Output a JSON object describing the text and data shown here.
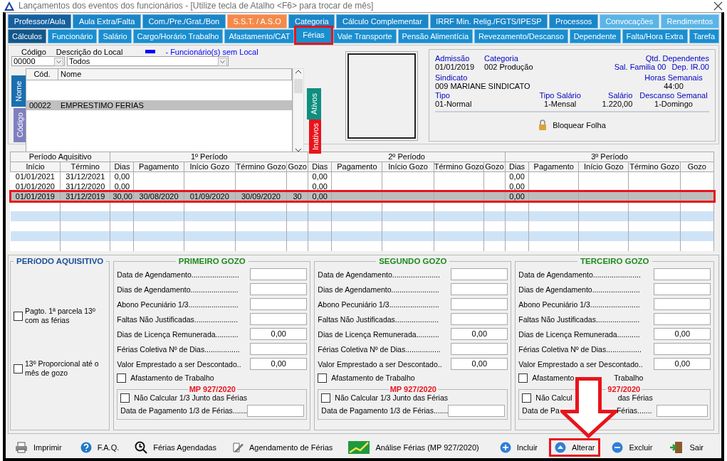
{
  "window": {
    "title": "Lançamentos dos eventos dos funcionários - [Utilize tecla de Atalho <F6> para trocar de mês]"
  },
  "tab_rows": [
    [
      {
        "label": "Professor/Aula",
        "color": "#15609e",
        "selected": false,
        "highlighted": false
      },
      {
        "label": "Aula Extra/Falta",
        "color": "#1a86c8",
        "selected": false,
        "highlighted": false
      },
      {
        "label": "Com./Pre./Grat./Bon",
        "color": "#1a86c8",
        "selected": false,
        "highlighted": false
      },
      {
        "label": "S.S.T. / A.S.O",
        "color": "#f5894a",
        "selected": false,
        "highlighted": false
      },
      {
        "label": "Categoria",
        "color": "#1a86c8",
        "selected": false,
        "highlighted": false
      },
      {
        "label": "Cálculo Complementar",
        "color": "#1a86c8",
        "selected": false,
        "highlighted": false
      },
      {
        "label": "IRRF Min. Relig./FGTS/IPESP",
        "color": "#1a86c8",
        "selected": false,
        "highlighted": false
      },
      {
        "label": "Processos",
        "color": "#1a86c8",
        "selected": false,
        "highlighted": false
      },
      {
        "label": "Convocações",
        "color": "#5ab4e6",
        "selected": false,
        "highlighted": false
      },
      {
        "label": "Rendimentos",
        "color": "#5ab4e6",
        "selected": false,
        "highlighted": false
      }
    ],
    [
      {
        "label": "Cálculos",
        "color": "#13578a",
        "selected": false,
        "highlighted": false
      },
      {
        "label": "Funcionário",
        "color": "#1a8fd0",
        "selected": false,
        "highlighted": false
      },
      {
        "label": "Salário",
        "color": "#1a8fd0",
        "selected": false,
        "highlighted": false
      },
      {
        "label": "Cargo/Horário Trabalho",
        "color": "#1a8fd0",
        "selected": false,
        "highlighted": false
      },
      {
        "label": "Afastamento/CAT",
        "color": "#1a8fd0",
        "selected": false,
        "highlighted": false
      },
      {
        "label": "Férias",
        "color": "#1a8fd0",
        "selected": true,
        "highlighted": true
      },
      {
        "label": "Vale Transporte",
        "color": "#1a8fd0",
        "selected": false,
        "highlighted": false
      },
      {
        "label": "Pensão Alimentícia",
        "color": "#1a8fd0",
        "selected": false,
        "highlighted": false
      },
      {
        "label": "Revezamento/Descanso",
        "color": "#1a8fd0",
        "selected": false,
        "highlighted": false
      },
      {
        "label": "Dependente",
        "color": "#1a8fd0",
        "selected": false,
        "highlighted": false
      },
      {
        "label": "Falta/Hora Extra",
        "color": "#1a8fd0",
        "selected": false,
        "highlighted": false
      },
      {
        "label": "Tarefa",
        "color": "#1a8fd0",
        "selected": false,
        "highlighted": false
      }
    ]
  ],
  "filter": {
    "code_label": "Código",
    "code_value": "00000",
    "local_label": "Descrição do Local",
    "local_value": "Todos",
    "legend": "- Funcionário(s) sem Local"
  },
  "employee_list": {
    "side_tabs": [
      {
        "label": "Nome",
        "color": "#1a6fb0",
        "selected": true
      },
      {
        "label": "Código",
        "color": "#7f7fc0",
        "selected": false
      }
    ],
    "columns": [
      "Cód.",
      "Nome"
    ],
    "rows": [
      {
        "code": "00022",
        "name": "EMPRESTIMO FERIAS",
        "selected": true
      }
    ],
    "status_tabs": [
      {
        "label": "Ativos",
        "color": "#0f8f80",
        "selected": true
      },
      {
        "label": "Inativos",
        "color": "#e8141c",
        "selected": false
      }
    ]
  },
  "employee_info": {
    "admissao": {
      "label": "Admissão",
      "value": "01/01/2019"
    },
    "categoria": {
      "label": "Categoria",
      "value": "002  Produção"
    },
    "dependentes": {
      "label": "Qtd. Dependentes",
      "sal_familia": "Sal. Familia 00",
      "dep_ir": "Dep. IR.00"
    },
    "sindicato": {
      "label": "Sindicato",
      "value": "009  MARIANE SINDICATO"
    },
    "horas": {
      "label": "Horas Semanais",
      "value": "44:00"
    },
    "tipo": {
      "label": "Tipo",
      "value": "01-Normal"
    },
    "tipo_salario": {
      "label": "Tipo Salário",
      "value": "1-Mensal"
    },
    "salario": {
      "label": "Salário",
      "value": "1.220,00"
    },
    "descanso": {
      "label": "Descanso Semanal",
      "value": "1-Domingo"
    },
    "lock_label": "Bloquear Folha"
  },
  "periods_table": {
    "group_headers": [
      "Período Aquisitivo",
      "1º Período",
      "2º Período",
      "3º Período"
    ],
    "columns": [
      "Início",
      "Término",
      "Dias",
      "Pagamento",
      "Início Gozo",
      "Término Gozo",
      "Gozo",
      "Dias",
      "Pagamento",
      "Início Gozo",
      "Término Gozo",
      "Gozo",
      "Dias",
      "Pagamento",
      "Início Gozo",
      "Término Gozo",
      "Gozo"
    ],
    "rows": [
      {
        "inicio": "01/01/2021",
        "termino": "31/12/2021",
        "selected": false,
        "highlighted": false,
        "periods": [
          {
            "dias": "0,00"
          },
          {
            "dias": "0,00"
          },
          {
            "dias": "0,00"
          }
        ]
      },
      {
        "inicio": "01/01/2020",
        "termino": "31/12/2020",
        "selected": false,
        "highlighted": false,
        "periods": [
          {
            "dias": "0,00"
          },
          {
            "dias": "0,00"
          },
          {
            "dias": "0,00"
          }
        ]
      },
      {
        "inicio": "01/01/2019",
        "termino": "31/12/2019",
        "selected": true,
        "highlighted": true,
        "periods": [
          {
            "dias": "30,00",
            "pagamento": "30/08/2020",
            "inicio_gozo": "01/09/2020",
            "termino_gozo": "30/09/2020",
            "gozo": "30"
          },
          {
            "dias": "0,00"
          },
          {
            "dias": "0,00"
          }
        ]
      }
    ]
  },
  "periodo_aquisitivo": {
    "title": "PERíODO AQUISITIVO",
    "options": [
      {
        "label": "Pagto. 1ª parcela 13º com as férias",
        "checked": false
      },
      {
        "label": "13º Proporcional até o mês de gozo",
        "checked": false
      }
    ]
  },
  "gozos": [
    {
      "title": "PRIMEIRO GOZO",
      "arrow_over": false,
      "fields": [
        {
          "label": "Data de Agendamento......................."
        },
        {
          "label": "Dias de Agendamento......................."
        },
        {
          "label": "Abono Pecuniário 1/3........................"
        },
        {
          "label": "Faltas Não Justificadas....................."
        },
        {
          "label": "Dias de Licença Remunerada...........",
          "value": "0,00"
        },
        {
          "label": "Férias Coletiva Nº de Dias................."
        },
        {
          "label": "Valor Emprestado a ser Descontado..",
          "value": "0,00"
        }
      ],
      "afastamento": {
        "label_parts": [
          "Afastamento de Trabalho"
        ],
        "checked": false
      },
      "mp_title_parts": [
        "MP 927/2020"
      ],
      "mp_option": {
        "label_parts": [
          "Não Calcular 1/3 Junto das Férias"
        ],
        "checked": false
      },
      "mp_field": {
        "label_parts": [
          "Data de Pagamento 1/3 de Férias......."
        ]
      }
    },
    {
      "title": "SEGUNDO GOZO",
      "arrow_over": false,
      "fields": [
        {
          "label": "Data de Agendamento......................."
        },
        {
          "label": "Dias de Agendamento......................."
        },
        {
          "label": "Abono Pecuniário 1/3........................"
        },
        {
          "label": "Faltas Não Justificadas....................."
        },
        {
          "label": "Dias de Licença Remunerada...........",
          "value": "0,00"
        },
        {
          "label": "Férias Coletiva Nº de Dias................."
        },
        {
          "label": "Valor Emprestado a ser Descontado..",
          "value": "0,00"
        }
      ],
      "afastamento": {
        "label_parts": [
          "Afastamento de Trabalho"
        ],
        "checked": false
      },
      "mp_title_parts": [
        "MP 927/2020"
      ],
      "mp_option": {
        "label_parts": [
          "Não Calcular 1/3 Junto das Férias"
        ],
        "checked": false
      },
      "mp_field": {
        "label_parts": [
          "Data de Pagamento 1/3 de Férias......."
        ]
      }
    },
    {
      "title": "TERCEIRO GOZO",
      "arrow_over": true,
      "fields": [
        {
          "label": "Data de Agendamento......................."
        },
        {
          "label": "Dias de Agendamento......................."
        },
        {
          "label": "Abono Pecuniário 1/3........................"
        },
        {
          "label": "Faltas Não Justificadas....................."
        },
        {
          "label": "Dias de Licença Remunerada...........",
          "value": "0,00"
        },
        {
          "label": "Férias Coletiva Nº de Dias................."
        },
        {
          "label": "Valor Emprestado a ser Descontado..",
          "value": "0,00"
        }
      ],
      "afastamento": {
        "label_parts": [
          "Afastamento",
          "Trabalho"
        ],
        "checked": false
      },
      "mp_title_parts": [
        "927/2020"
      ],
      "mp_option": {
        "label_parts": [
          "Não Calcul",
          "das Férias"
        ],
        "checked": false
      },
      "mp_field": {
        "label_parts": [
          "Data de Pa",
          "Férias......."
        ]
      }
    }
  ],
  "toolbar": {
    "left": [
      {
        "label": "Imprimir",
        "kind": "printer"
      },
      {
        "label": "F.A.Q.",
        "kind": "help"
      },
      {
        "label": "Férias Agendadas",
        "kind": "clock"
      },
      {
        "label": "Agendamento de Férias",
        "kind": "edit"
      },
      {
        "label": "Análise Férias (MP 927/2020)",
        "kind": "chart"
      }
    ],
    "right": [
      {
        "label": "Incluir",
        "kind": "plus",
        "highlighted": false
      },
      {
        "label": "Alterar",
        "kind": "up",
        "highlighted": true
      },
      {
        "label": "Excluir",
        "kind": "minus",
        "highlighted": false
      },
      {
        "label": "Sair",
        "kind": "exit",
        "highlighted": false
      }
    ]
  },
  "annotation_arrow": true
}
